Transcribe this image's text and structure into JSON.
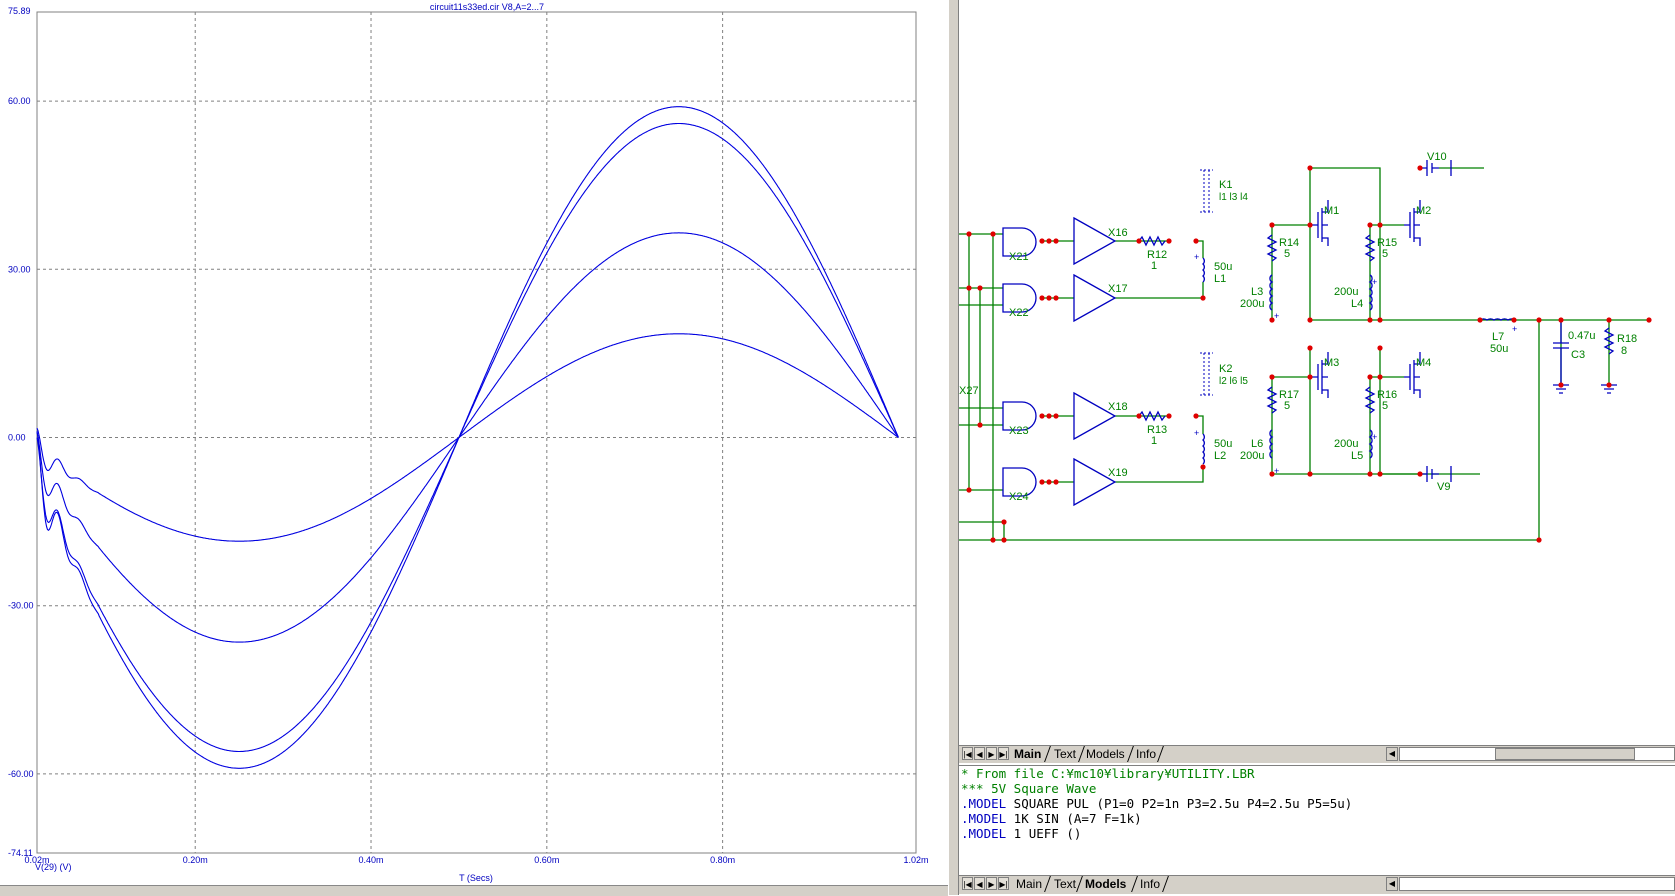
{
  "plot": {
    "title": "circuit11s33ed.cir V8,A=2...7",
    "y_top_label": "75.89",
    "y_bottom_label": "-74.11",
    "x_axis_label": "T (Secs)",
    "y_axis_label": "V(29) (V)",
    "trace_color": "#0000e0"
  },
  "chart_data": {
    "type": "line",
    "title": "circuit11s33ed.cir V8,A=2...7",
    "xlabel": "T (Secs)",
    "ylabel": "V(29) (V)",
    "xlim": [
      2e-05,
      0.00102
    ],
    "ylim": [
      -74.11,
      75.89
    ],
    "x_tick_labels": [
      "0.02m",
      "0.20m",
      "0.40m",
      "0.60m",
      "0.80m",
      "1.02m"
    ],
    "x_ticks": [
      2e-05,
      0.0002,
      0.0004,
      0.0006,
      0.0008,
      0.00102
    ],
    "y_tick_labels": [
      "60.00",
      "30.00",
      "0.00",
      "-30.00",
      "-60.00"
    ],
    "y_ticks": [
      60,
      30,
      0,
      -30,
      -60
    ],
    "grid": true,
    "series": [
      {
        "amplitude_peak": 18.5,
        "clipped": false
      },
      {
        "amplitude_peak": 36.5,
        "clipped": false
      },
      {
        "amplitude_peak": 56.0,
        "clipped": false
      },
      {
        "amplitude_peak": 59.0,
        "clipped": true
      }
    ]
  },
  "schematic": {
    "wire_color": "#008000",
    "part_color": "#0000c0",
    "label_color": "#008000",
    "node_color": "#e00000",
    "labels": {
      "k1": "K1",
      "k1_list": "l1 l3 l4",
      "k2": "K2",
      "k2_list": "l2 l6 l5",
      "x16": "X16",
      "x17": "X17",
      "x18": "X18",
      "x19": "X19",
      "x21": "X21",
      "x22": "X22",
      "x23": "X23",
      "x24": "X24",
      "x27": "X27",
      "r12": "R12",
      "r12v": "1",
      "r13": "R13",
      "r13v": "1",
      "l1": "L1",
      "l1v": "50u",
      "l2": "L2",
      "l2v": "50u",
      "r14": "R14",
      "r14v": "5",
      "r15": "R15",
      "r15v": "5",
      "r16": "R16",
      "r16v": "5",
      "r17": "R17",
      "r17v": "5",
      "l3": "L3",
      "l3v": "200u",
      "l4": "L4",
      "l4v": "200u",
      "l5": "L5",
      "l5v": "200u",
      "l6": "L6",
      "l6v": "200u",
      "m1": "M1",
      "m2": "M2",
      "m3": "M3",
      "m4": "M4",
      "v10": "V10",
      "v9": "V9",
      "l7": "L7",
      "l7v": "50u",
      "c3": "C3",
      "c3v": "0.47u",
      "r18": "R18",
      "r18v": "8"
    }
  },
  "tabs_top": {
    "items": [
      "Main",
      "Text",
      "Models",
      "Info"
    ],
    "active": "Main"
  },
  "tabs_bottom": {
    "items": [
      "Main",
      "Text",
      "Models",
      "Info"
    ],
    "active": "Models"
  },
  "code": {
    "line1": "* From file C:¥mc10¥library¥UTILITY.LBR",
    "line2": "*** 5V Square Wave",
    "line3_kw": ".MODEL",
    "line3_rest": " SQUARE PUL (P1=0 P2=1n P3=2.5u P4=2.5u P5=5u)",
    "line4_kw": ".MODEL",
    "line4_rest": " 1K SIN (A=7 F=1k)",
    "line5_kw": ".MODEL",
    "line5_rest": " 1 UEFF ()"
  }
}
